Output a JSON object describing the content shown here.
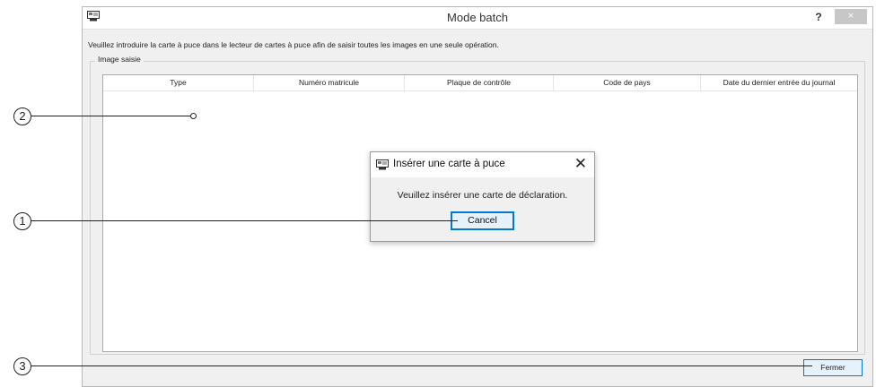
{
  "window": {
    "title": "Mode batch",
    "help_label": "?",
    "close_label": "×",
    "icon": "smart-card-reader-icon"
  },
  "instruction_text": "Veuillez introduire la carte à puce dans le lecteur de cartes à puce afin de saisir toutes les images en une seule opération.",
  "group": {
    "legend": "Image saisie",
    "columns": [
      "Type",
      "Numéro matricule",
      "Plaque de contrôle",
      "Code de pays",
      "Date du dernier entrée du journal"
    ]
  },
  "footer": {
    "close_label": "Fermer"
  },
  "dialog": {
    "title": "Insérer une carte à puce",
    "close_label": "✕",
    "message": "Veuillez insérer une carte de déclaration.",
    "cancel_label": "Cancel",
    "icon": "smart-card-reader-icon"
  },
  "callouts": {
    "one": "1",
    "two": "2",
    "three": "3"
  }
}
